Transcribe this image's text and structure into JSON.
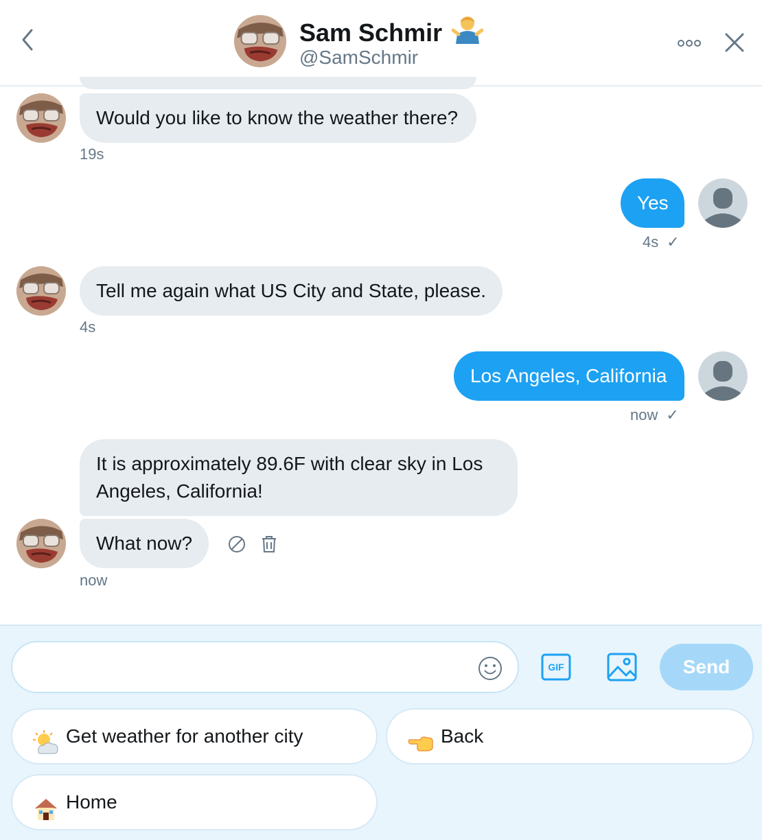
{
  "header": {
    "name": "Sam Schmir",
    "handle": "@SamSchmir"
  },
  "messages": [
    {
      "direction": "in",
      "text": "Would you like to know the weather there?",
      "time": "19s"
    },
    {
      "direction": "out",
      "text": "Yes",
      "time": "4s"
    },
    {
      "direction": "in",
      "text": "Tell me again what US City and State, please.",
      "time": "4s"
    },
    {
      "direction": "out",
      "text": "Los Angeles, California",
      "time": "now"
    },
    {
      "direction": "in",
      "text_line1": "It is approximately 89.6F with clear sky in Los",
      "text_line2": "Angeles, California!"
    },
    {
      "direction": "in",
      "text": "What now?",
      "time": "now"
    }
  ],
  "composer": {
    "input_value": "",
    "send_label": "Send",
    "gif_label": "GIF"
  },
  "quick_replies": [
    {
      "label": "Get weather for another city",
      "icon": "sun-behind-cloud-icon"
    },
    {
      "label": "Back",
      "icon": "pointing-left-hand-icon"
    },
    {
      "label": "Home",
      "icon": "house-icon"
    }
  ],
  "colors": {
    "accent": "#1da1f2",
    "incoming_bubble": "#e6ecf0",
    "composer_bg": "#e8f5fd",
    "send_disabled": "#a5d8f8",
    "muted_text": "#657786"
  }
}
